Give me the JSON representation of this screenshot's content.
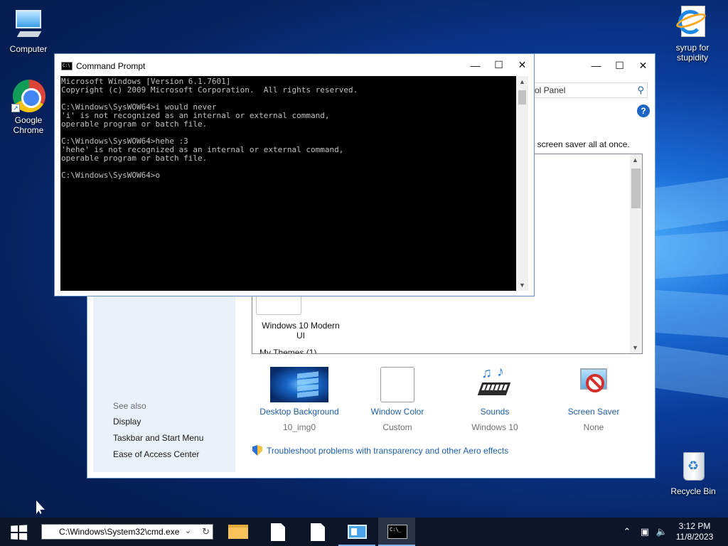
{
  "desktop": {
    "icons": [
      {
        "label": "Computer",
        "icon": "computer-icon"
      },
      {
        "label": "Google Chrome",
        "icon": "chrome-icon"
      },
      {
        "label": "syrup for stupidity",
        "icon": "internet-explorer-icon"
      },
      {
        "label": "Recycle Bin",
        "icon": "recycle-bin-icon"
      }
    ]
  },
  "personalization": {
    "search_value": "ol Panel",
    "description": "nd screen saver all at once.",
    "theme_name": "Windows 10 Modern UI",
    "my_themes": "My Themes (1)",
    "see_also": "See also",
    "links": [
      "Display",
      "Taskbar and Start Menu",
      "Ease of Access Center"
    ],
    "items": [
      {
        "label": "Desktop Background",
        "sub": "10_img0"
      },
      {
        "label": "Window Color",
        "sub": "Custom"
      },
      {
        "label": "Sounds",
        "sub": "Windows 10"
      },
      {
        "label": "Screen Saver",
        "sub": "None"
      }
    ],
    "troubleshoot": "Troubleshoot problems with transparency and other Aero effects"
  },
  "cmd": {
    "title": "Command Prompt",
    "icon_text": "C:\\",
    "lines": [
      "Microsoft Windows [Version 6.1.7601]",
      "Copyright (c) 2009 Microsoft Corporation.  All rights reserved.",
      "",
      "C:\\Windows\\SysWOW64>i would never",
      "'i' is not recognized as an internal or external command,",
      "operable program or batch file.",
      "",
      "C:\\Windows\\SysWOW64>hehe :3",
      "'hehe' is not recognized as an internal or external command,",
      "operable program or batch file.",
      "",
      "C:\\Windows\\SysWOW64>o"
    ]
  },
  "taskbar": {
    "address": "C:\\Windows\\System32\\cmd.exe",
    "time": "3:12 PM",
    "date": "11/8/2023",
    "cmd_icon_text": "C:\\_"
  }
}
